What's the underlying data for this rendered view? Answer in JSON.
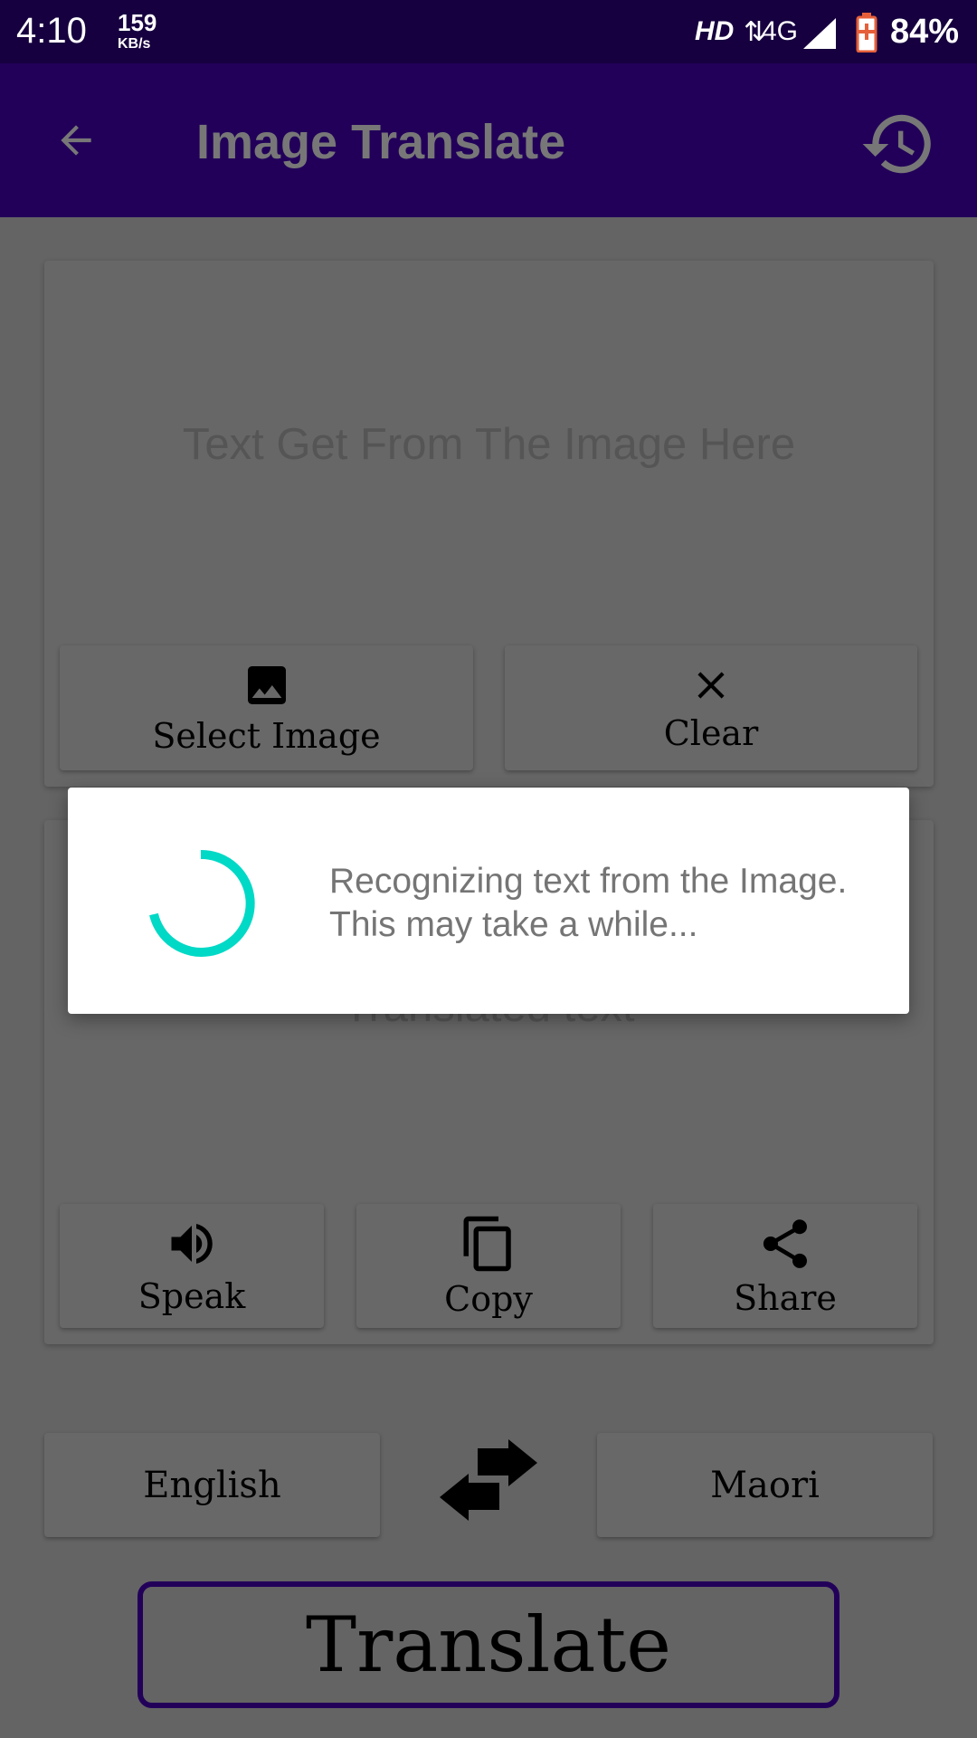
{
  "status_bar": {
    "time": "4:10",
    "speed_value": "159",
    "speed_unit": "KB/s",
    "hd": "HD",
    "network": "4G",
    "battery": "84%"
  },
  "toolbar": {
    "title": "Image Translate",
    "back_icon": "arrow-back-icon",
    "history_icon": "history-icon"
  },
  "source_card": {
    "placeholder": "Text Get From The Image Here",
    "select_image_label": "Select Image",
    "clear_label": "Clear"
  },
  "result_card": {
    "placeholder": "Translated text",
    "speak_label": "Speak",
    "copy_label": "Copy",
    "share_label": "Share"
  },
  "languages": {
    "source": "English",
    "target": "Maori"
  },
  "translate_label": "Translate",
  "dialog": {
    "message": "Recognizing text from the Image. This may take a while..."
  },
  "colors": {
    "primary": "#22005a",
    "status_bar": "#16003f",
    "spinner": "#00d9c6",
    "translate_border": "#22005a"
  }
}
